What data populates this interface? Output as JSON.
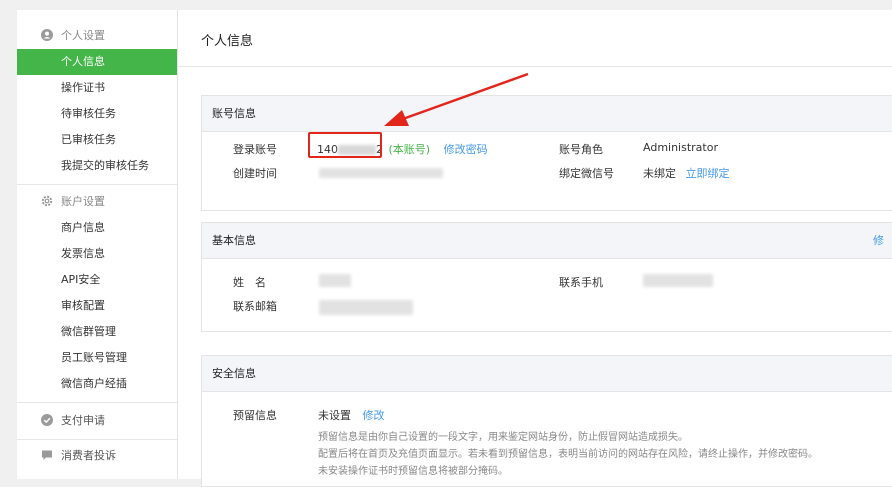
{
  "sidebar": {
    "groups": [
      {
        "title": "个人设置",
        "icon": "person-circle-icon",
        "items": [
          "个人信息",
          "操作证书",
          "待审核任务",
          "已审核任务",
          "我提交的审核任务"
        ]
      },
      {
        "title": "账户设置",
        "icon": "gear-icon",
        "items": [
          "商户信息",
          "发票信息",
          "API安全",
          "审核配置",
          "微信群管理",
          "员工账号管理",
          "微信商户经插"
        ]
      },
      {
        "title": "支付申请",
        "icon": "check-circle-icon"
      },
      {
        "title": "消费者投诉",
        "icon": "chat-bubble-icon"
      }
    ],
    "active_item": "个人信息"
  },
  "page": {
    "title": "个人信息"
  },
  "account_panel": {
    "title": "账号信息",
    "login_label": "登录账号",
    "login_prefix": "140",
    "login_suffix": "2",
    "login_tag": "(本账号)",
    "change_password": "修改密码",
    "role_label": "账号角色",
    "role_value": "Administrator",
    "created_label": "创建时间",
    "wechat_label": "绑定微信号",
    "wechat_status": "未绑定",
    "bind_now": "立即绑定"
  },
  "basic_panel": {
    "title": "基本信息",
    "edit": "修",
    "name_label": "姓　名",
    "phone_label": "联系手机",
    "email_label": "联系邮箱"
  },
  "security_panel": {
    "title": "安全信息",
    "reserve_label": "预留信息",
    "reserve_status": "未设置",
    "modify": "修改",
    "hints": [
      "预留信息是由你自己设置的一段文字，用来鉴定网站身份，防止假冒网站造成损失。",
      "配置后将在首页及充值页面显示。若未看到预留信息，表明当前访问的网站存在风险，请终止操作，并修改密码。",
      "未安装操作证书时预留信息将被部分掩码。"
    ]
  },
  "annotation": {
    "color": "#e3261c"
  }
}
